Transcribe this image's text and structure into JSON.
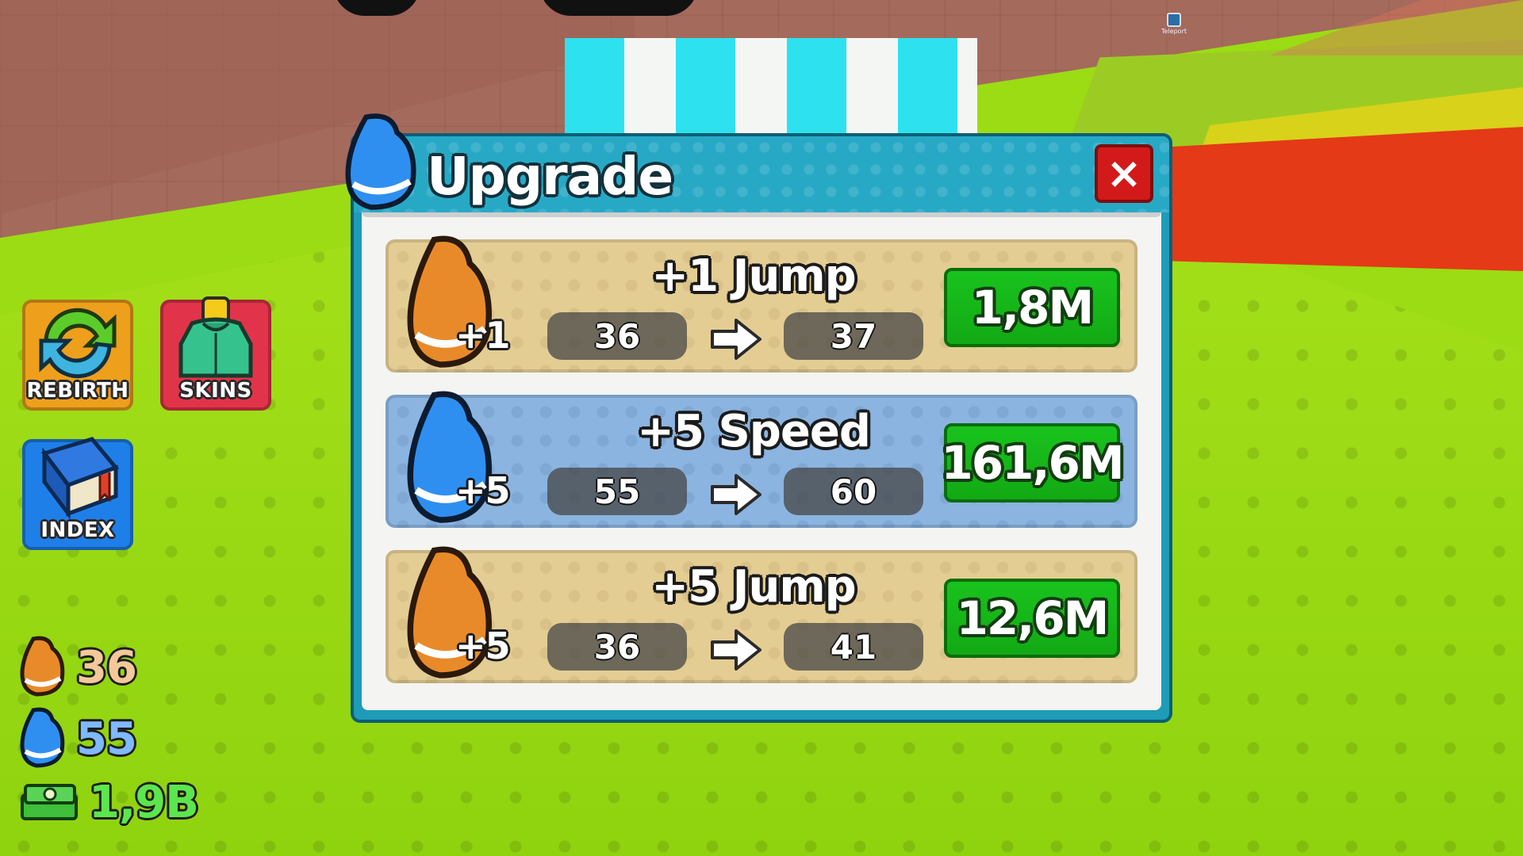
{
  "world": {
    "teleport_label": "Teleport"
  },
  "hud": {
    "rebirth_label": "REBIRTH",
    "skins_label": "SKINS",
    "index_label": "INDEX"
  },
  "stats": {
    "jump": "36",
    "speed": "55",
    "cash": "1,9B"
  },
  "panel": {
    "title": "Upgrade",
    "close_label": "×",
    "cards": [
      {
        "title": "+1 Jump",
        "plus": "+1",
        "from": "36",
        "to": "37",
        "price": "1,8M",
        "variant": "jump"
      },
      {
        "title": "+5 Speed",
        "plus": "+5",
        "from": "55",
        "to": "60",
        "price": "161,6M",
        "variant": "speed"
      },
      {
        "title": "+5 Jump",
        "plus": "+5",
        "from": "36",
        "to": "41",
        "price": "12,6M",
        "variant": "jump"
      }
    ]
  },
  "colors": {
    "panel_frame": "#1e9cb7",
    "buy_green": "#12a914",
    "close_red": "#d21a1a",
    "card_tan": "#e4cd93",
    "card_blue": "#8bb4e0"
  },
  "icons": {
    "jump": "orange-shoe-icon",
    "speed": "blue-shoe-icon",
    "cash": "cash-stack-icon",
    "rebirth": "rebirth-arrows-icon",
    "skins": "hoodie-icon",
    "index": "book-icon",
    "next": "arrow-right-icon"
  }
}
